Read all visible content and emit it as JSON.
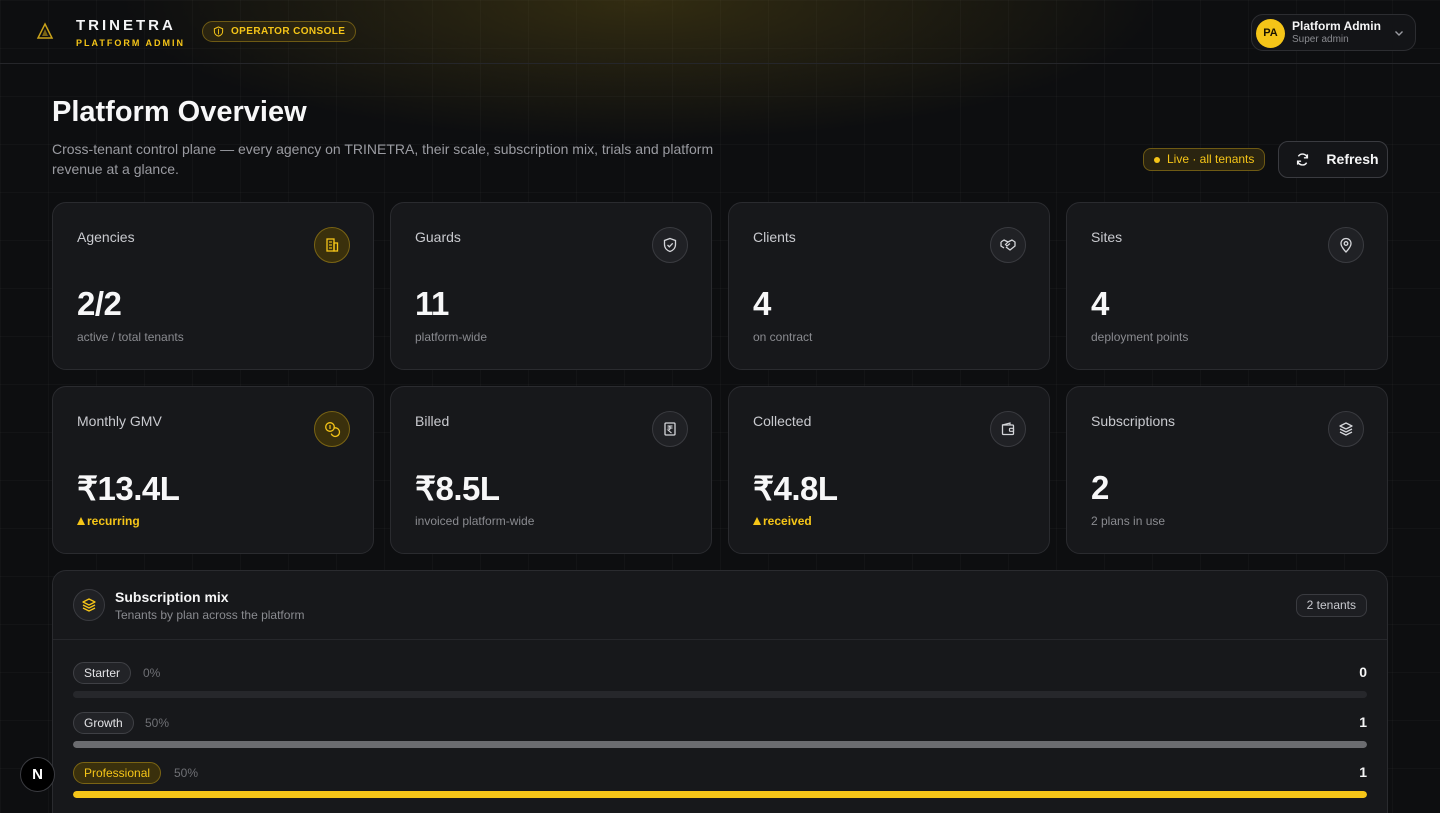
{
  "header": {
    "brand_name": "TRINETRA",
    "brand_sub": "PLATFORM ADMIN",
    "console_badge": "OPERATOR CONSOLE",
    "user": {
      "initials": "PA",
      "name": "Platform Admin",
      "role": "Super admin"
    }
  },
  "page": {
    "title": "Platform Overview",
    "description": "Cross-tenant control plane — every agency on TRINETRA, their scale, subscription mix, trials and platform revenue at a glance.",
    "live_badge": "Live · all tenants",
    "refresh_label": "Refresh"
  },
  "stats": [
    {
      "label": "Agencies",
      "value": "2/2",
      "sub": "active / total tenants",
      "icon": "building-icon"
    },
    {
      "label": "Guards",
      "value": "11",
      "sub": "platform-wide",
      "icon": "shield-check-icon"
    },
    {
      "label": "Clients",
      "value": "4",
      "sub": "on contract",
      "icon": "handshake-icon"
    },
    {
      "label": "Sites",
      "value": "4",
      "sub": "deployment points",
      "icon": "map-pin-icon"
    },
    {
      "label": "Monthly GMV",
      "value": "₹13.4L",
      "sub": "recurring",
      "icon": "coins-icon"
    },
    {
      "label": "Billed",
      "value": "₹8.5L",
      "sub": "invoiced platform-wide",
      "icon": "receipt-rupee-icon"
    },
    {
      "label": "Collected",
      "value": "₹4.8L",
      "sub": "received",
      "icon": "wallet-icon"
    },
    {
      "label": "Subscriptions",
      "value": "2",
      "sub": "2 plans in use",
      "icon": "layers-icon"
    }
  ],
  "subscription_mix": {
    "title": "Subscription mix",
    "subtitle": "Tenants by plan across the platform",
    "tenant_count": "2 tenants",
    "plans": [
      {
        "name": "Starter",
        "pct": "0%",
        "count": "0",
        "fraction": 0
      },
      {
        "name": "Growth",
        "pct": "50%",
        "count": "1",
        "fraction": 1
      },
      {
        "name": "Professional",
        "pct": "50%",
        "count": "1",
        "fraction": 1
      }
    ]
  },
  "dev_badge": "N",
  "colors": {
    "accent": "#f5c518",
    "background": "#0d0e10",
    "card": "#17181b"
  }
}
